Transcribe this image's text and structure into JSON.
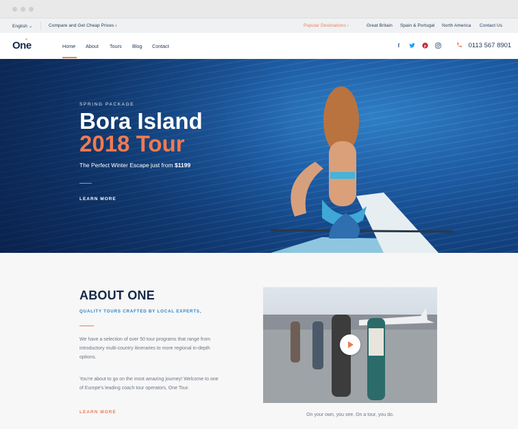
{
  "topbar": {
    "language": "English ⌄",
    "compare": "Compare and Get Cheap Prices ›",
    "popular": "Popular Destinations ›",
    "links": [
      "Great Britain",
      "Spain & Portugal",
      "North America",
      "Contact Us"
    ]
  },
  "nav": {
    "logo": "One",
    "items": [
      "Home",
      "About",
      "Tours",
      "Blog",
      "Contact"
    ],
    "phone": "0113 567 8901",
    "social_icons": [
      "facebook-icon",
      "twitter-icon",
      "pinterest-icon",
      "instagram-icon"
    ]
  },
  "hero": {
    "kicker": "SPRING PACKAGE",
    "title_line1": "Bora Island",
    "title_line2": "2018 Tour",
    "subtitle_prefix": "The Perfect Winter Escape just from ",
    "price": "$1199",
    "cta": "LEARN MORE"
  },
  "about": {
    "title": "ABOUT ONE",
    "subtitle": "QUALITY TOURS CRAFTED BY LOCAL EXPERTS,",
    "para1": "We have a selection of over 50 tour programs that range from introductory multi-country itineraries to more regional in-depth options.",
    "para2": "You're about to go on the most amazing journey! Welcome to one of Europe's leading coach tour operators, One Tour.",
    "cta": "LEARN MORE",
    "video_caption": "On your own, you see. On a tour, you do."
  },
  "colors": {
    "accent": "#f07a52",
    "navy": "#142949",
    "link_blue": "#2b82c9"
  }
}
